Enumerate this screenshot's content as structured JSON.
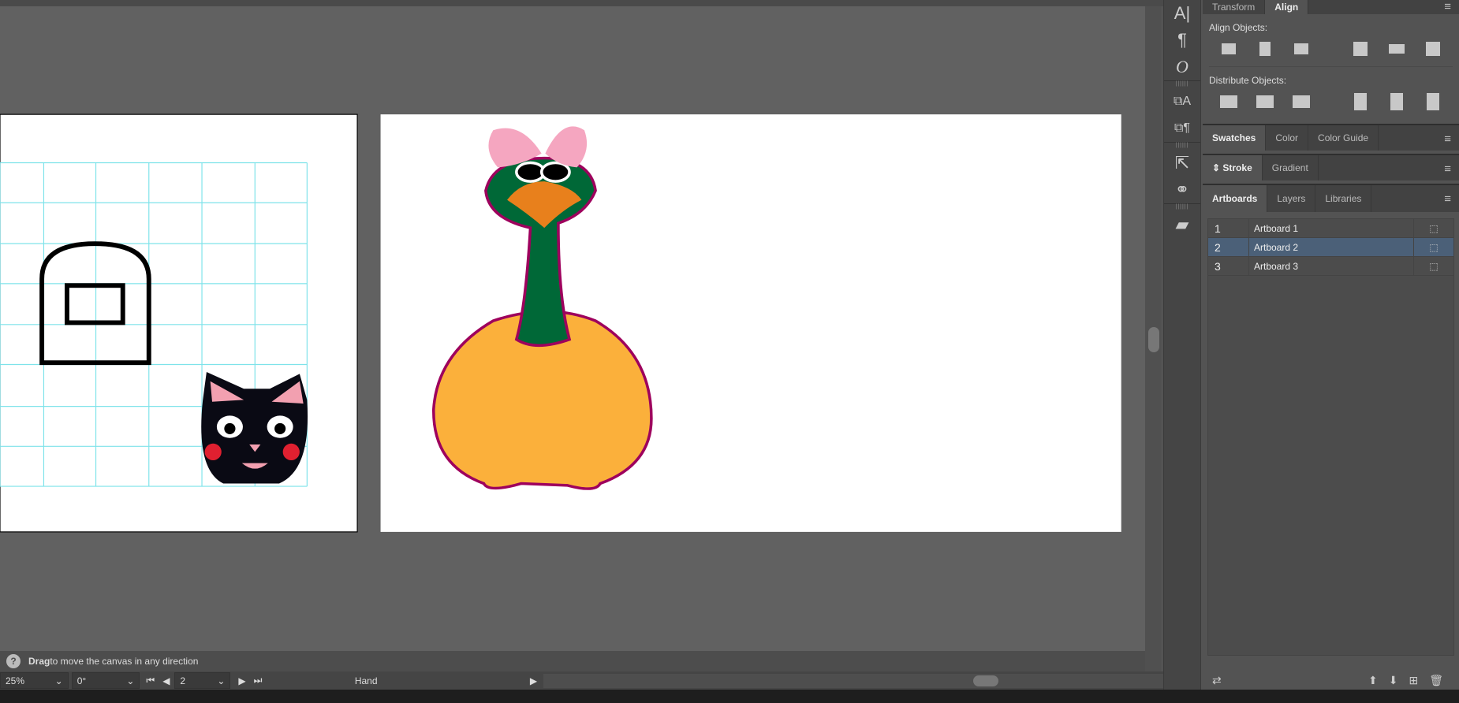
{
  "tools": [
    "type-icon",
    "paragraph-icon",
    "opentype-icon",
    "char-styles-icon",
    "para-styles-icon",
    "export-icon",
    "links-icon",
    "comments-icon"
  ],
  "panel": {
    "tabs_top": [
      "Transform",
      "Align"
    ],
    "align_label": "Align Objects:",
    "distribute_label": "Distribute Objects:",
    "tabs_swatch": [
      "Swatches",
      "Color",
      "Color Guide"
    ],
    "tabs_stroke": [
      "Stroke",
      "Gradient"
    ],
    "tabs_artboards": [
      "Artboards",
      "Layers",
      "Libraries"
    ],
    "artboards": [
      {
        "n": "1",
        "name": "Artboard 1"
      },
      {
        "n": "2",
        "name": "Artboard 2"
      },
      {
        "n": "3",
        "name": "Artboard 3"
      }
    ],
    "selected_artboard": "2"
  },
  "status": {
    "bold": "Drag",
    "text": " to move the canvas in any direction"
  },
  "bottom": {
    "zoom": "25%",
    "rotation": "0°",
    "artboard": "2",
    "tool": "Hand"
  },
  "colors": {
    "canvas": "#616161",
    "panel": "#535353",
    "selected": "#4b6078",
    "guide": "#7ee3ea"
  }
}
